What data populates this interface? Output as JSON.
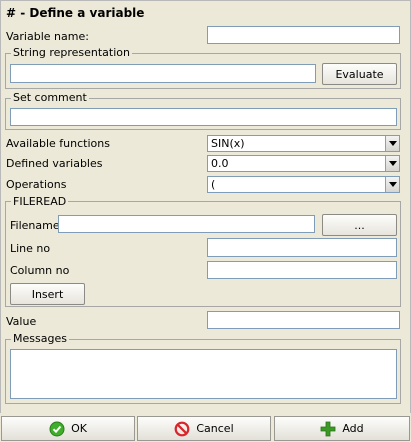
{
  "dialog": {
    "title": "# - Define a variable",
    "variable_name_label": "Variable name:",
    "variable_name_value": "",
    "string_rep_group": "String representation",
    "string_rep_value": "",
    "evaluate_button": "Evaluate",
    "set_comment_group": "Set comment",
    "comment_value": "",
    "available_functions_label": "Available functions",
    "available_functions_selected": "SIN(x)",
    "defined_variables_label": "Defined variables",
    "defined_variables_selected": "0.0",
    "operations_label": "Operations",
    "operations_selected": "(",
    "fileread_group": "FILEREAD",
    "filename_label": "Filename",
    "filename_value": "",
    "browse_button": "...",
    "line_no_label": "Line no",
    "line_no_value": "",
    "column_no_label": "Column no",
    "column_no_value": "",
    "insert_button": "Insert",
    "value_label": "Value",
    "value_value": "",
    "messages_group": "Messages",
    "messages_value": ""
  },
  "footer": {
    "ok_label": "OK",
    "cancel_label": "Cancel",
    "add_label": "Add"
  },
  "colors": {
    "dialog_bg": "#ece9d8",
    "field_border": "#7f9db9",
    "ok_icon": "#3fae2a",
    "cancel_icon": "#d8262a",
    "add_icon": "#3a9a25"
  },
  "icons": {
    "ok": "check-circle-icon",
    "cancel": "no-entry-icon",
    "add": "plus-icon",
    "dropdown": "chevron-down-icon"
  }
}
